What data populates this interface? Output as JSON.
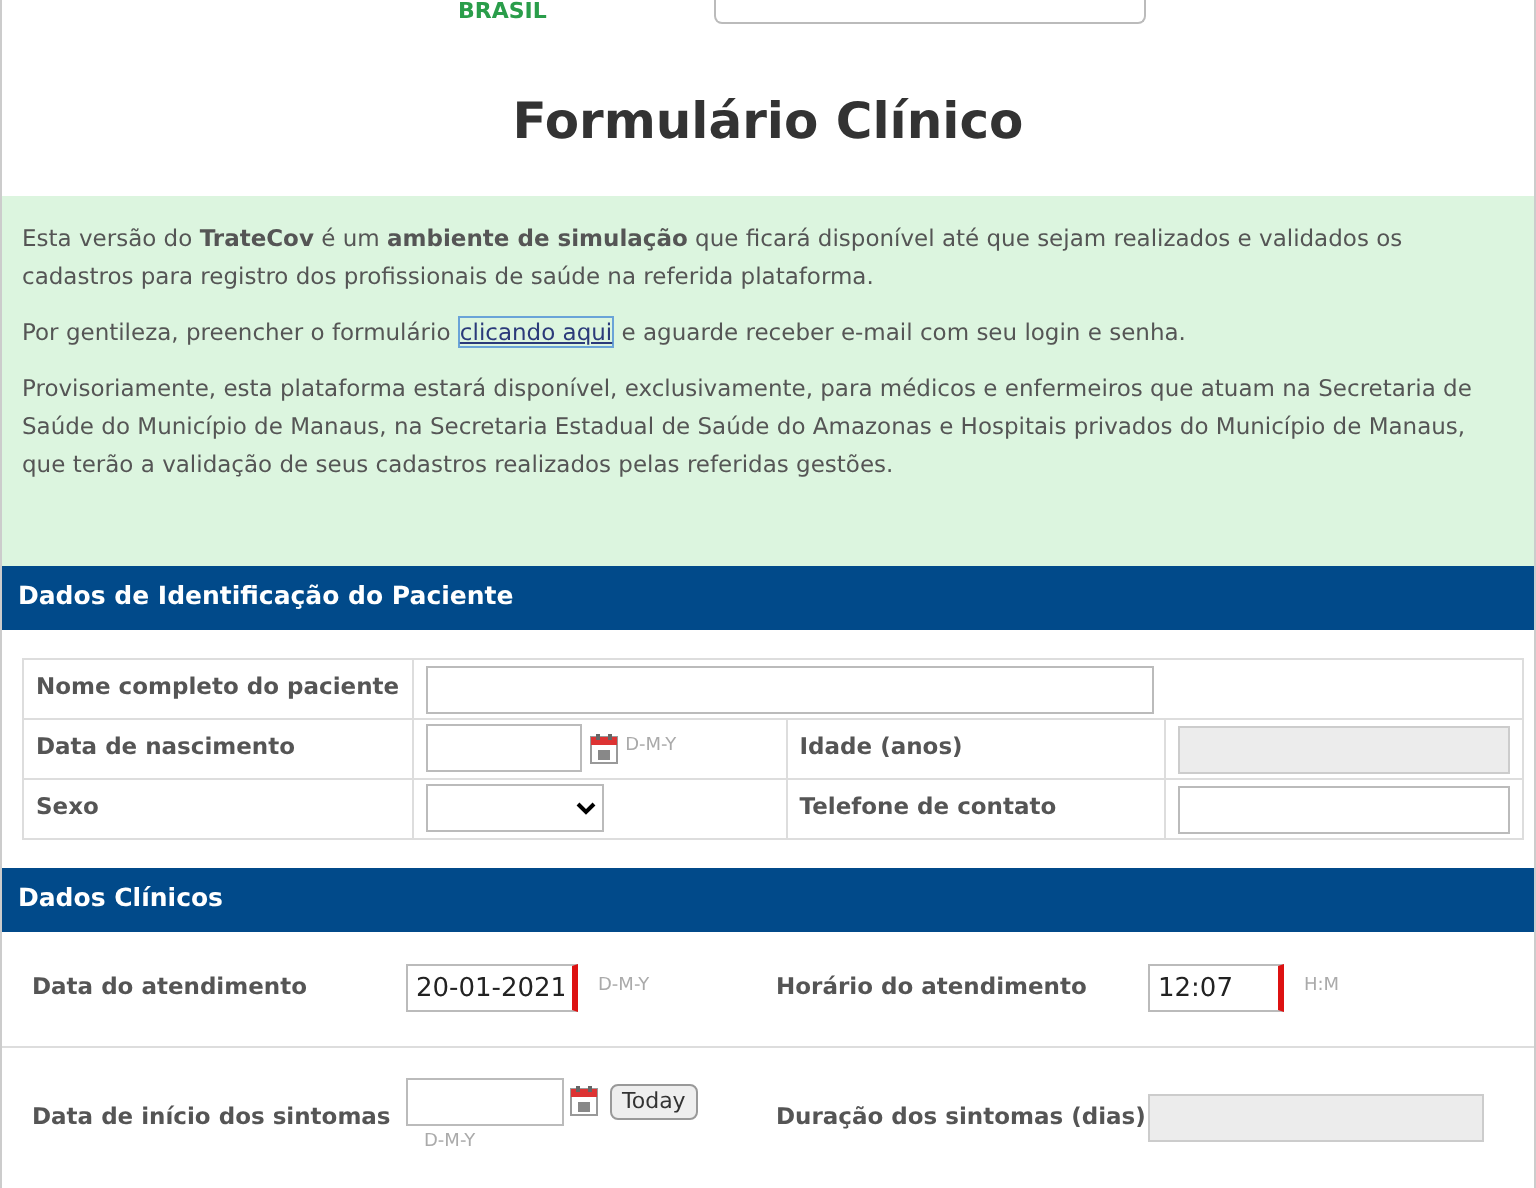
{
  "logo": {
    "text": "BRASIL"
  },
  "title": "Formulário Clínico",
  "notice": {
    "paragraphs": [
      {
        "text": "Esta versão do **TrateCov** é um **ambiente de simulação** que ficará disponível até que sejam realizados e validados os cadastros para registro dos profissionais de saúde na referida plataforma."
      },
      {
        "before": "Por gentileza, preencher o formulário ",
        "link": "clicando aqui",
        "after": " e aguarde receber e-mail com seu login e senha."
      },
      {
        "text": "Provisoriamente, esta plataforma estará disponível, exclusivamente, para médicos e enfermeiros que atuam na Secretaria de Saúde do Município de Manaus, na Secretaria Estadual de Saúde do Amazonas e Hospitais privados do Município de Manaus, que terão a validação de seus cadastros realizados pelas referidas gestões."
      }
    ]
  },
  "identification": {
    "header": "Dados de Identificação do Paciente",
    "name_label": "Nome completo do paciente",
    "birth_label": "Data de nascimento",
    "birth_format": "D-M-Y",
    "age_label": "Idade (anos)",
    "sex_label": "Sexo",
    "phone_label": "Telefone de contato"
  },
  "clinical": {
    "header": "Dados Clínicos",
    "date_label": "Data do atendimento",
    "date_value": "20-01-2021",
    "date_format": "D-M-Y",
    "date_required": true,
    "time_label": "Horário do atendimento",
    "time_value": "12:07",
    "time_format": "H:M",
    "time_required": true,
    "onset_label": "Data de início dos sintomas",
    "onset_format": "D-M-Y",
    "today_button": "Today",
    "duration_label": "Duração dos sintomas (dias)"
  }
}
